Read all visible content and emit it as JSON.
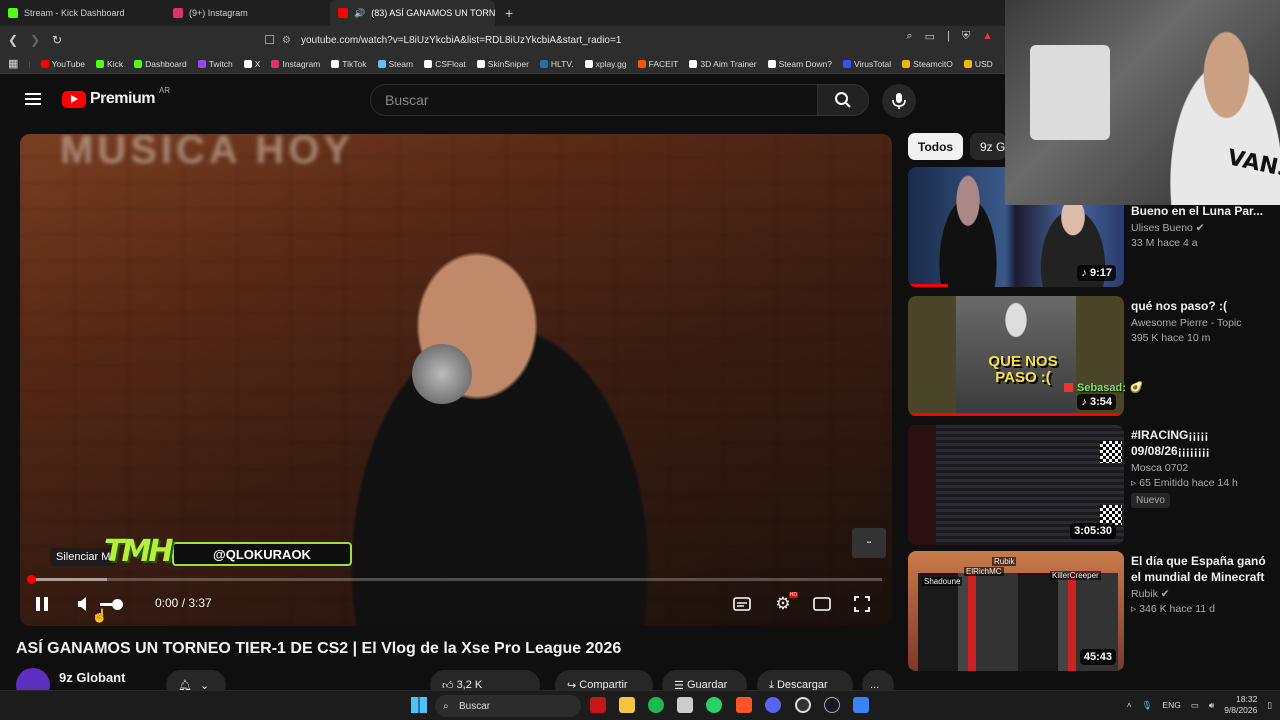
{
  "browser": {
    "tabs": [
      {
        "label": "Stream - Kick Dashboard",
        "color": "#53fc18"
      },
      {
        "label": "(9+) Instagram",
        "color": "#e1306c"
      },
      {
        "label": "(83) ASÍ GANAMOS UN TORNEO",
        "color": "#ff0000",
        "active": true
      }
    ],
    "url": "youtube.com/watch?v=L8iUzYkcbiA&list=RDL8iUzYkcbiA&start_radio=1",
    "bookmarks": [
      {
        "label": "YouTube",
        "color": "#ff0000"
      },
      {
        "label": "Kick",
        "color": "#53fc18"
      },
      {
        "label": "Dashboard",
        "color": "#53fc18"
      },
      {
        "label": "Twitch",
        "color": "#9146ff"
      },
      {
        "label": "X",
        "color": "#ffffff"
      },
      {
        "label": "Instagram",
        "color": "#e1306c"
      },
      {
        "label": "TikTok",
        "color": "#ffffff"
      },
      {
        "label": "Steam",
        "color": "#66c0f4"
      },
      {
        "label": "CSFloat",
        "color": "#ffffff"
      },
      {
        "label": "SkinSniper",
        "color": "#ffffff"
      },
      {
        "label": "HLTV.",
        "color": "#2b6ea4"
      },
      {
        "label": "xplay.gg",
        "color": "#ffffff"
      },
      {
        "label": "FACEIT",
        "color": "#ff5500"
      },
      {
        "label": "3D Aim Trainer",
        "color": "#ffffff"
      },
      {
        "label": "Steam Down?",
        "color": "#ffffff"
      },
      {
        "label": "VirusTotal",
        "color": "#394eff"
      },
      {
        "label": "SteamcitO",
        "color": "#f5b400"
      },
      {
        "label": "USD",
        "color": "#f5b400"
      }
    ]
  },
  "youtube": {
    "logo_text": "Premium",
    "country_code": "AR",
    "search_placeholder": "Buscar"
  },
  "player": {
    "overlay_handle": "@QLOKURAOK",
    "overlay_logo": "TMH",
    "tooltip": "Silenciar",
    "tooltip_key": "M",
    "time": "0:00 / 3:37",
    "banner_text": "MUSICA HOY",
    "played_fraction": 0.005,
    "buffered_fraction": 0.09,
    "volume_fraction": 1.0
  },
  "video": {
    "title": "ASÍ GANAMOS UN TORNEO TIER-1 DE CS2 | El Vlog de la Xse Pro League 2026",
    "channel": "9z Globant",
    "actions": [
      "3,2 K",
      "",
      "Compartir",
      "Guardar",
      "Descargar",
      "..."
    ]
  },
  "chips": [
    "Todos",
    "9z Globant"
  ],
  "recommendations": [
    {
      "title": "Bueno en el Luna Par...",
      "channel": "Ulises Bueno",
      "verified": true,
      "meta": "33 M   hace 4 a",
      "duration": "9:17",
      "music": true,
      "thumb": "#2a4a7a"
    },
    {
      "title": "qué nos paso? :(",
      "channel": "Awesome Pierre - Topic",
      "verified": false,
      "meta": "395 K   hace 10 m",
      "duration": "3:54",
      "music": true,
      "thumb": "#5a4a2a",
      "thumb_text": "QUE NOS PASO :("
    },
    {
      "title": "#IRACING¡¡¡¡¡ 09/08/26¡¡¡¡¡¡¡¡",
      "channel": "Mosca 0702",
      "verified": false,
      "meta": "65   Emitido hace 14 h",
      "duration": "3:05:30",
      "music": false,
      "badge": "Nuevo",
      "thumb": "#1e1e22"
    },
    {
      "title": "El día que España ganó el mundial de Minecraft",
      "channel": "Rubik",
      "verified": true,
      "meta": "346 K   hace 11 d",
      "duration": "45:43",
      "music": false,
      "thumb": "#8a4a2a",
      "thumb_tags": [
        "Rubik",
        "ElRichMC",
        "Shadoune",
        "KillerCreeper"
      ]
    }
  ],
  "chat_overlay": {
    "name": "Sebasad:"
  },
  "taskbar": {
    "search_label": "Buscar",
    "lang": "ENG",
    "time": "18:32",
    "date": "9/8/2026"
  }
}
